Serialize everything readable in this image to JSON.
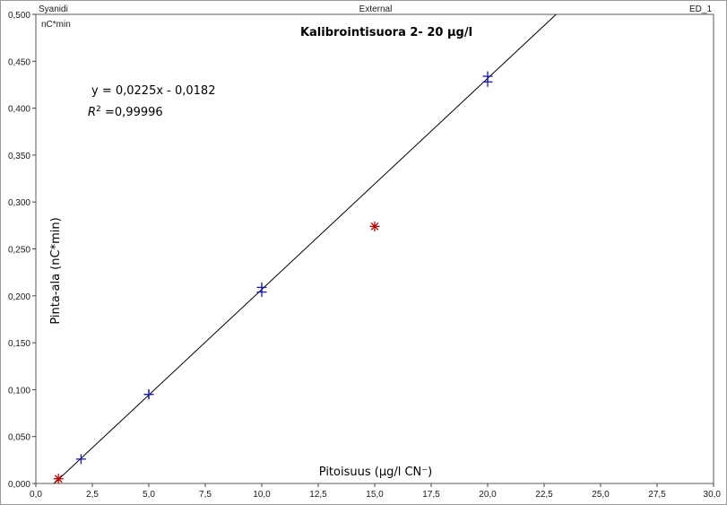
{
  "header": {
    "left": "Syanidi",
    "center": "External",
    "right": "ED_1"
  },
  "chart_data": {
    "type": "scatter",
    "title": "Kalibrointisuora 2- 20 µg/l",
    "unit_label": "nC*min",
    "xlabel": "Pitoisuus (µg/l CN⁻)",
    "ylabel": "Pinta-ala (nC*min)",
    "xlim": [
      0,
      30
    ],
    "ylim": [
      0,
      0.5
    ],
    "x_ticks": [
      "0,0",
      "2,5",
      "5,0",
      "7,5",
      "10,0",
      "12,5",
      "15,0",
      "17,5",
      "20,0",
      "22,5",
      "25,0",
      "27,5",
      "30,0"
    ],
    "y_ticks": [
      "0,000",
      "0,050",
      "0,100",
      "0,150",
      "0,200",
      "0,250",
      "0,300",
      "0,350",
      "0,400",
      "0,450",
      "0,500"
    ],
    "grid": false,
    "equation": "y = 0,0225x - 0,0182",
    "r2_value": "=0,99996",
    "fit_line": {
      "slope": 0.0225,
      "intercept": -0.0182,
      "color": "#000000"
    },
    "series": [
      {
        "marker": "plus",
        "color": "#1a1aa8",
        "x": [
          2,
          5,
          5,
          10,
          10,
          20,
          20
        ],
        "y": [
          0.026,
          0.095,
          0.095,
          0.204,
          0.209,
          0.428,
          0.434
        ]
      },
      {
        "marker": "asterisk",
        "color": "#b00000",
        "x": [
          1,
          15
        ],
        "y": [
          0.005,
          0.274
        ]
      }
    ]
  }
}
